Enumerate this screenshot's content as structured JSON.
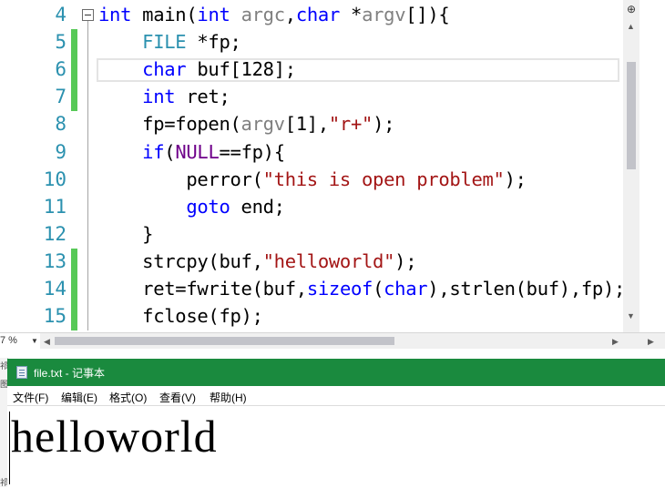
{
  "editor": {
    "lines": [
      {
        "num": "4",
        "changed": false,
        "tokens": [
          {
            "t": "int",
            "c": "kw"
          },
          {
            "t": " main(",
            "c": "fn"
          },
          {
            "t": "int",
            "c": "kw"
          },
          {
            "t": " ",
            "c": "fn"
          },
          {
            "t": "argc",
            "c": "pm"
          },
          {
            "t": ",",
            "c": "fn"
          },
          {
            "t": "char",
            "c": "kw"
          },
          {
            "t": " *",
            "c": "fn"
          },
          {
            "t": "argv",
            "c": "pm"
          },
          {
            "t": "[]){",
            "c": "fn"
          }
        ]
      },
      {
        "num": "5",
        "changed": true,
        "tokens": [
          {
            "t": "    ",
            "c": "fn"
          },
          {
            "t": "FILE",
            "c": "ty"
          },
          {
            "t": " *fp;",
            "c": "fn"
          }
        ]
      },
      {
        "num": "6",
        "changed": true,
        "tokens": [
          {
            "t": "    ",
            "c": "fn"
          },
          {
            "t": "char",
            "c": "kw"
          },
          {
            "t": " buf[128];",
            "c": "fn"
          }
        ]
      },
      {
        "num": "7",
        "changed": true,
        "tokens": [
          {
            "t": "    ",
            "c": "fn"
          },
          {
            "t": "int",
            "c": "kw"
          },
          {
            "t": " ret;",
            "c": "fn"
          }
        ]
      },
      {
        "num": "8",
        "changed": false,
        "tokens": [
          {
            "t": "    fp=fopen(",
            "c": "fn"
          },
          {
            "t": "argv",
            "c": "pm"
          },
          {
            "t": "[1],",
            "c": "fn"
          },
          {
            "t": "\"r+\"",
            "c": "st"
          },
          {
            "t": ");",
            "c": "fn"
          }
        ]
      },
      {
        "num": "9",
        "changed": false,
        "tokens": [
          {
            "t": "    ",
            "c": "fn"
          },
          {
            "t": "if",
            "c": "kw"
          },
          {
            "t": "(",
            "c": "fn"
          },
          {
            "t": "NULL",
            "c": "mc"
          },
          {
            "t": "==fp){",
            "c": "fn"
          }
        ]
      },
      {
        "num": "10",
        "changed": false,
        "tokens": [
          {
            "t": "        perror(",
            "c": "fn"
          },
          {
            "t": "\"this is open problem\"",
            "c": "st"
          },
          {
            "t": ");",
            "c": "fn"
          }
        ]
      },
      {
        "num": "11",
        "changed": false,
        "tokens": [
          {
            "t": "        ",
            "c": "fn"
          },
          {
            "t": "goto",
            "c": "kw"
          },
          {
            "t": " end;",
            "c": "fn"
          }
        ]
      },
      {
        "num": "12",
        "changed": false,
        "tokens": [
          {
            "t": "    }",
            "c": "fn"
          }
        ]
      },
      {
        "num": "13",
        "changed": true,
        "tokens": [
          {
            "t": "    strcpy(buf,",
            "c": "fn"
          },
          {
            "t": "\"helloworld\"",
            "c": "st"
          },
          {
            "t": ");",
            "c": "fn"
          }
        ]
      },
      {
        "num": "14",
        "changed": true,
        "tokens": [
          {
            "t": "    ret=fwrite(buf,",
            "c": "fn"
          },
          {
            "t": "sizeof",
            "c": "kw"
          },
          {
            "t": "(",
            "c": "fn"
          },
          {
            "t": "char",
            "c": "kw"
          },
          {
            "t": "),strlen(buf),fp);",
            "c": "fn"
          }
        ]
      },
      {
        "num": "15",
        "changed": true,
        "tokens": [
          {
            "t": "    fclose(fp);",
            "c": "fn"
          }
        ]
      }
    ],
    "zoom": "7 %"
  },
  "notepad": {
    "title": "file.txt - 记事本",
    "menu": [
      {
        "label": "文件(F)",
        "name": "menu-file"
      },
      {
        "label": "编辑(E)",
        "name": "menu-edit"
      },
      {
        "label": "格式(O)",
        "name": "menu-format"
      },
      {
        "label": "查看(V)",
        "name": "menu-view"
      },
      {
        "label": "帮助(H)",
        "name": "menu-help"
      }
    ],
    "content": "helloworld"
  },
  "colors": {
    "notepad_titlebar": "#1a8a3e",
    "change_bar": "#57c957",
    "line_number": "#2b91af",
    "keyword": "#0000ff",
    "string": "#a31515"
  },
  "icons": {
    "collapse": "collapse-minus-icon",
    "notepad": "notepad-icon",
    "split": "split-view-icon"
  },
  "strip": {
    "top_char": "祁",
    "mid_char": "图",
    "bottom_char": "祁"
  }
}
